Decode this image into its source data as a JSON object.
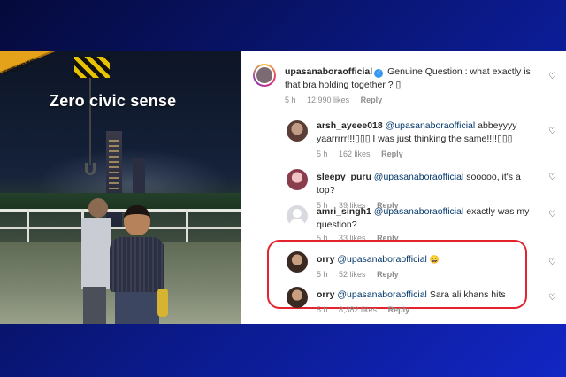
{
  "photo": {
    "caption": "Zero civic sense",
    "crane_label": "ESCORTS"
  },
  "comments": {
    "main": {
      "user": "upasanaboraofficial",
      "text": "Genuine Question : what exactly is that bra holding together ? ▯",
      "time": "5 h",
      "likes": "12,990 likes",
      "reply": "Reply"
    },
    "replies": [
      {
        "user": "arsh_ayeee018",
        "mention": "@upasanaboraofficial",
        "text": "abbeyyyy yaarrrrr!!!▯▯▯ I was just thinking the same!!!!▯▯▯",
        "time": "5 h",
        "likes": "162 likes",
        "reply": "Reply"
      },
      {
        "user": "sleepy_puru",
        "mention": "@upasanaboraofficial",
        "text": "sooooo, it's a top?",
        "time": "5 h",
        "likes": "39 likes",
        "reply": "Reply"
      },
      {
        "user": "amri_singh1",
        "mention": "@upasanaboraofficial",
        "text": "exactly was my question?",
        "time": "5 h",
        "likes": "33 likes",
        "reply": "Reply"
      },
      {
        "user": "orry",
        "mention": "@upasanaboraofficial",
        "text": "😀",
        "time": "5 h",
        "likes": "52 likes",
        "reply": "Reply"
      },
      {
        "user": "orry",
        "mention": "@upasanaboraofficial",
        "text": "Sara ali khans hits",
        "time": "5 h",
        "likes": "8,382 likes",
        "reply": "Reply"
      }
    ]
  },
  "icons": {
    "heart": "♡",
    "verified": "✓"
  },
  "colors": {
    "highlight": "#e3232e",
    "mention": "#00376b",
    "verified": "#3897f0"
  }
}
